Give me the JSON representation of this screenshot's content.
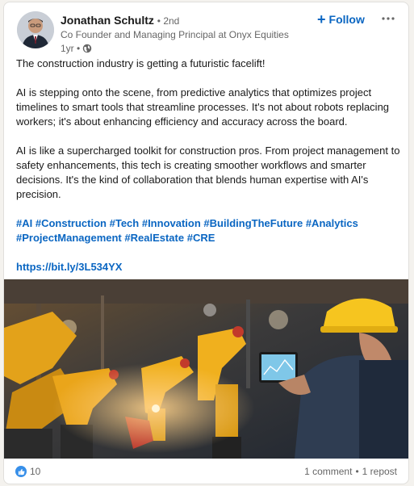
{
  "author": {
    "name": "Jonathan Schultz",
    "degree": "• 2nd",
    "headline": "Co Founder and Managing Principal at Onyx Equities",
    "time": "1yr •"
  },
  "actions": {
    "follow_label": "Follow",
    "follow_icon": "+",
    "more_icon": "more-horizontal-icon"
  },
  "post": {
    "paragraphs": [
      "The construction industry is getting a futuristic facelift!",
      "AI is stepping onto the scene, from predictive analytics that optimizes project timelines to smart tools that streamline processes. It's not about robots replacing workers; it's about enhancing efficiency and accuracy across the board.",
      "AI is like a supercharged toolkit for construction pros. From project management to safety enhancements, this tech is creating smoother workflows and smarter decisions. It's the kind of collaboration that blends human expertise with AI's precision."
    ],
    "hashtags": [
      "#AI",
      "#Construction",
      "#Tech",
      "#Innovation",
      "#BuildingTheFuture",
      "#Analytics",
      "#ProjectManagement",
      "#RealEstate",
      "#CRE"
    ],
    "link": "https://bit.ly/3L534YX"
  },
  "social": {
    "reaction_count": "10",
    "comments": "1 comment",
    "separator": "•",
    "reposts": "1 repost"
  },
  "colors": {
    "link": "#0a66c2",
    "like": "#378fe9",
    "muted": "#666666"
  }
}
